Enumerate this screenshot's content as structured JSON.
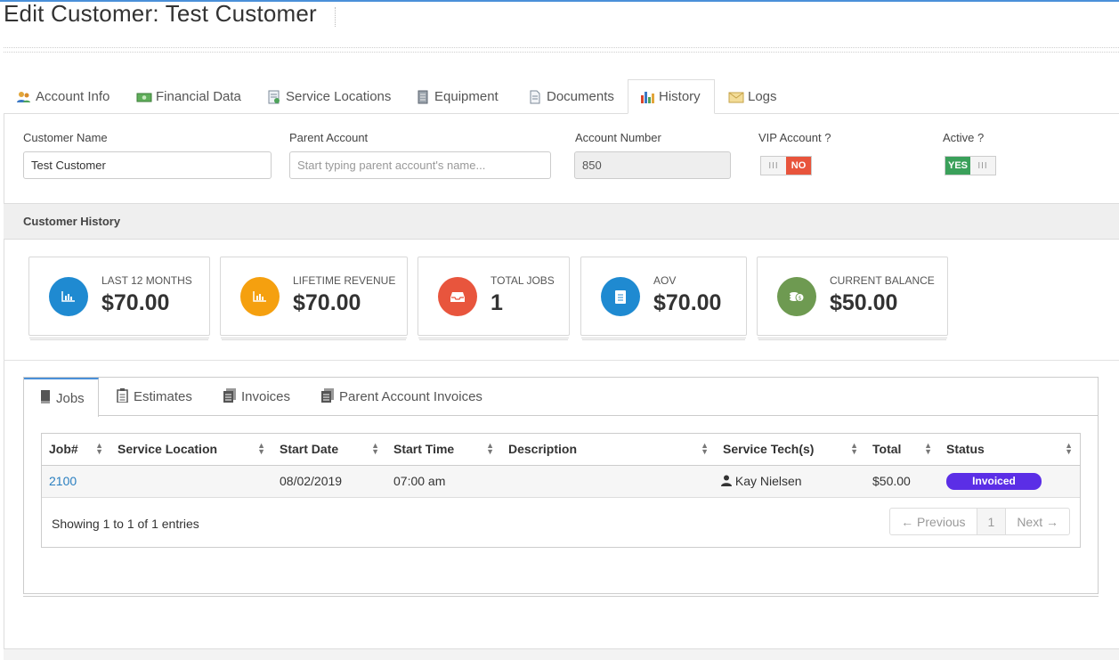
{
  "page_title": "Edit Customer: Test Customer",
  "main_tabs": [
    {
      "label": "Account Info",
      "icon": "users-icon"
    },
    {
      "label": "Financial Data",
      "icon": "money-icon"
    },
    {
      "label": "Service Locations",
      "icon": "map-document-icon"
    },
    {
      "label": "Equipment",
      "icon": "server-icon"
    },
    {
      "label": "Documents",
      "icon": "document-icon"
    },
    {
      "label": "History",
      "icon": "bar-chart-icon",
      "active": true
    },
    {
      "label": "Logs",
      "icon": "envelope-icon"
    }
  ],
  "form": {
    "customer_name_label": "Customer Name",
    "customer_name_value": "Test Customer",
    "parent_account_label": "Parent Account",
    "parent_account_placeholder": "Start typing parent account's name...",
    "account_number_label": "Account Number",
    "account_number_value": "850",
    "vip_label": "VIP Account ?",
    "vip_toggle_text": "NO",
    "active_label": "Active ?",
    "active_toggle_text": "YES",
    "toggle_grip": "III"
  },
  "section_title": "Customer History",
  "stats": [
    {
      "label": "LAST 12 MONTHS",
      "value": "$70.00",
      "color": "#1f8ad1",
      "icon": "bar-chart-icon"
    },
    {
      "label": "LIFETIME REVENUE",
      "value": "$70.00",
      "color": "#f5a00f",
      "icon": "bar-chart-icon"
    },
    {
      "label": "TOTAL JOBS",
      "value": "1",
      "color": "#e8553d",
      "icon": "inbox-icon"
    },
    {
      "label": "AOV",
      "value": "$70.00",
      "color": "#1f8ad1",
      "icon": "document-icon"
    },
    {
      "label": "CURRENT BALANCE",
      "value": "$50.00",
      "color": "#6e9a51",
      "icon": "coins-icon"
    }
  ],
  "inner_tabs": [
    {
      "label": "Jobs",
      "active": true
    },
    {
      "label": "Estimates"
    },
    {
      "label": "Invoices"
    },
    {
      "label": "Parent Account Invoices"
    }
  ],
  "table": {
    "columns": [
      "Job#",
      "Service Location",
      "Start Date",
      "Start Time",
      "Description",
      "Service Tech(s)",
      "Total",
      "Status"
    ],
    "rows": [
      {
        "job": "2100",
        "location": "",
        "start_date": "08/02/2019",
        "start_time": "07:00 am",
        "description": "",
        "tech": "Kay Nielsen",
        "total": "$50.00",
        "status": "Invoiced"
      }
    ],
    "status_color": "#5b2ee6"
  },
  "pagination": {
    "showing": "Showing 1 to 1 of 1 entries",
    "previous": "← Previous",
    "page": "1",
    "next": "Next →"
  }
}
